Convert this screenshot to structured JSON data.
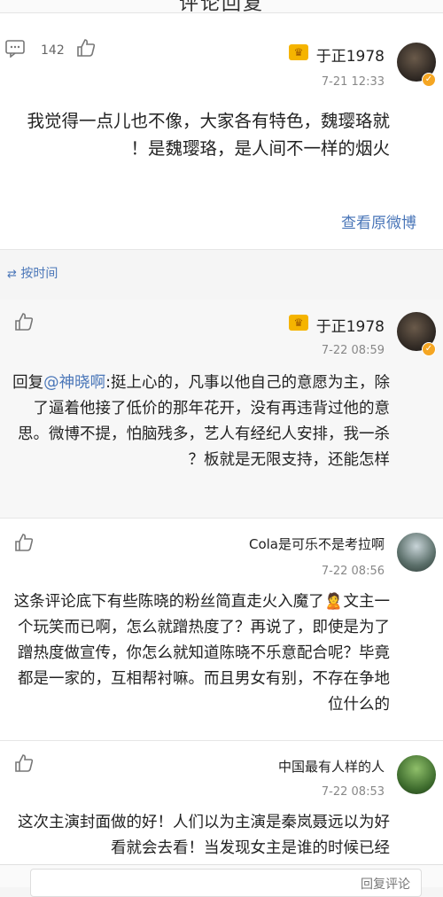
{
  "header": {
    "title": "评论回复"
  },
  "original_post": {
    "username": "于正1978",
    "time": "7-21 12:33",
    "like_count": "142",
    "content": "我觉得一点儿也不像，大家各有特色，魏璎珞就是魏璎珞，是人间不一样的烟火！",
    "view_weibo_label": "查看原微博"
  },
  "sort": {
    "label": "按时间"
  },
  "replies": [
    {
      "username": "于正1978",
      "time": "7-22 08:59",
      "mention": "@神晓啊",
      "content_prefix": "回复",
      "content": ":挺上心的，凡事以他自己的意愿为主，除了逼着他接了低价的那年花开，没有再违背过他的意思。微博不提，怕脑残多，艺人有经纪人安排，我一杀板就是无限支持，还能怎样？"
    },
    {
      "username": "Cola是可乐不是考拉啊",
      "time": "7-22 08:56",
      "content": "这条评论底下有些陈晓的粉丝简直走火入魔了🙎文主一个玩笑而已啊，怎么就蹭热度了？再说了，即使是为了蹭热度做宣传，你怎么就知道陈晓不乐意配合呢？毕竟都是一家的，互相帮衬嘛。而且男女有别，不存在争地位什么的"
    },
    {
      "username": "中国最有人样的人",
      "time": "7-22 08:53",
      "content": "这次主演封面做的好！人们以为主演是秦岚聂远以为好看就会去看！当发现女主是谁的时候已经"
    }
  ],
  "reply_bar": {
    "placeholder": "回复评论"
  },
  "icons": {
    "comment": "comment-icon",
    "like": "thumbs-up-icon",
    "crown": "crown-icon",
    "verified": "verified-badge-icon"
  },
  "colors": {
    "link": "#4a76b8",
    "crown": "#f5b400",
    "verified": "#f5a623"
  }
}
